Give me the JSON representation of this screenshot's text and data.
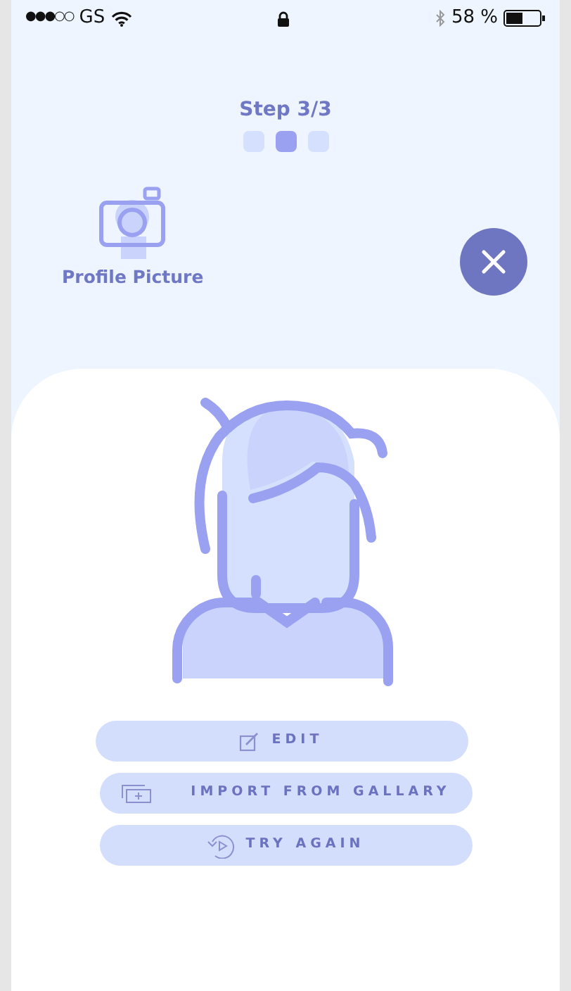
{
  "status_bar": {
    "signal": "●●●○○",
    "carrier": "GS",
    "battery": "58 %"
  },
  "step": {
    "label": "Step 3/3",
    "dots": [
      {
        "selected": false
      },
      {
        "selected": true
      },
      {
        "selected": false
      }
    ]
  },
  "section": {
    "label": "Profile Picture"
  },
  "buttons": [
    {
      "kind": "edit",
      "label": "EDIT"
    },
    {
      "kind": "gallery",
      "label": "IMPORT FROM GALLARY"
    },
    {
      "kind": "retry",
      "label": "TRY AGAIN"
    }
  ]
}
